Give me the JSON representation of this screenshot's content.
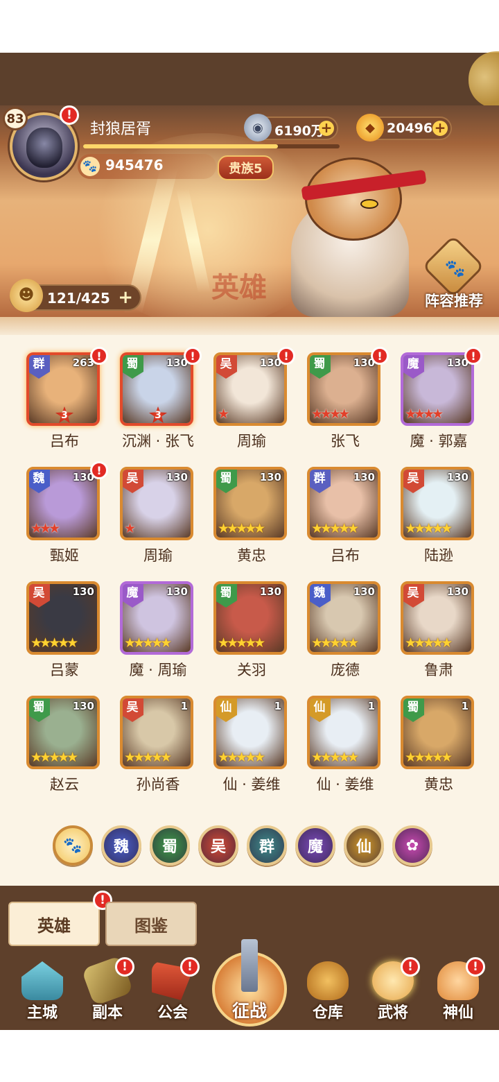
{
  "player": {
    "level": "83",
    "name": "封狼居胥",
    "power": "945476",
    "noble": "贵族5",
    "silver": "6190万",
    "gold": "20496",
    "alert": "!"
  },
  "header": {
    "watermark": "英雄",
    "roster_count": "121/425",
    "lineup_label": "阵容推荐"
  },
  "heroes": [
    {
      "name": "吕布",
      "faction": "群",
      "level": "263",
      "stars": "",
      "red_stars": "3",
      "alert": true
    },
    {
      "name": "沉渊 · 张飞",
      "faction": "蜀",
      "level": "130",
      "stars": "",
      "red_stars": "3",
      "alert": true
    },
    {
      "name": "周瑜",
      "faction": "吴",
      "level": "130",
      "stars": "★",
      "red_stars": "",
      "alert": true
    },
    {
      "name": "张飞",
      "faction": "蜀",
      "level": "130",
      "stars": "★★★★",
      "red_stars": "",
      "alert": true
    },
    {
      "name": "魔 · 郭嘉",
      "faction": "魔",
      "level": "130",
      "stars": "★★★★",
      "red_stars": "",
      "alert": true
    },
    {
      "name": "甄姬",
      "faction": "魏",
      "level": "130",
      "stars": "★★★",
      "red_stars": "",
      "alert": true
    },
    {
      "name": "周瑜",
      "faction": "吴",
      "level": "130",
      "stars": "★",
      "red_stars": "",
      "alert": false
    },
    {
      "name": "黄忠",
      "faction": "蜀",
      "level": "130",
      "stars": "★★★★★",
      "red_stars": "",
      "alert": false
    },
    {
      "name": "吕布",
      "faction": "群",
      "level": "130",
      "stars": "★★★★★",
      "red_stars": "",
      "alert": false
    },
    {
      "name": "陆逊",
      "faction": "吴",
      "level": "130",
      "stars": "★★★★★",
      "red_stars": "",
      "alert": false
    },
    {
      "name": "吕蒙",
      "faction": "吴",
      "level": "130",
      "stars": "★★★★★",
      "red_stars": "",
      "alert": false
    },
    {
      "name": "魔 · 周瑜",
      "faction": "魔",
      "level": "130",
      "stars": "★★★★★",
      "red_stars": "",
      "alert": false
    },
    {
      "name": "关羽",
      "faction": "蜀",
      "level": "130",
      "stars": "★★★★★",
      "red_stars": "",
      "alert": false
    },
    {
      "name": "庞德",
      "faction": "魏",
      "level": "130",
      "stars": "★★★★★",
      "red_stars": "",
      "alert": false
    },
    {
      "name": "鲁肃",
      "faction": "吴",
      "level": "130",
      "stars": "★★★★★",
      "red_stars": "",
      "alert": false
    },
    {
      "name": "赵云",
      "faction": "蜀",
      "level": "130",
      "stars": "★★★★★",
      "red_stars": "",
      "alert": false
    },
    {
      "name": "孙尚香",
      "faction": "吴",
      "level": "1",
      "stars": "★★★★★",
      "red_stars": "",
      "alert": false
    },
    {
      "name": "仙 · 姜维",
      "faction": "仙",
      "level": "1",
      "stars": "★★★★★",
      "red_stars": "",
      "alert": false
    },
    {
      "name": "仙 · 姜维",
      "faction": "仙",
      "level": "1",
      "stars": "★★★★★",
      "red_stars": "",
      "alert": false
    },
    {
      "name": "黄忠",
      "faction": "蜀",
      "level": "1",
      "stars": "★★★★★",
      "red_stars": "",
      "alert": false
    }
  ],
  "filters": [
    "🐾",
    "魏",
    "蜀",
    "吴",
    "群",
    "魔",
    "仙",
    "✿"
  ],
  "tabs": {
    "heroes": "英雄",
    "codex": "图鉴"
  },
  "nav": {
    "main_city": "主城",
    "dungeon": "副本",
    "guild": "公会",
    "campaign": "征战",
    "warehouse": "仓库",
    "generals": "武将",
    "immortals": "神仙"
  },
  "colors": {
    "faction_qun": "#5a5fc0",
    "faction_shu": "#3f9a4a",
    "faction_wu": "#d24a36",
    "faction_mo": "#9a5ac8",
    "faction_wei": "#4a5ec8",
    "faction_xian": "#d49a28",
    "alert": "#e22a24"
  }
}
